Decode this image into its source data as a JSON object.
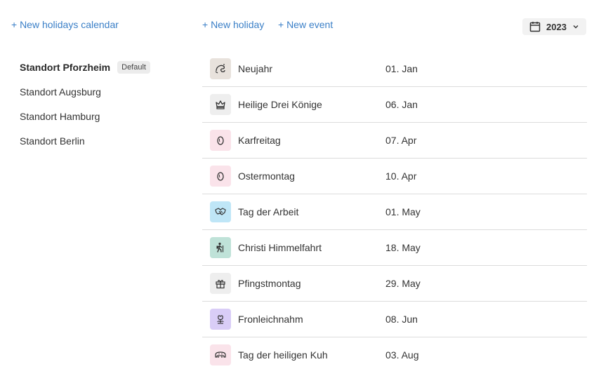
{
  "links": {
    "new_calendar": "+ New holidays calendar",
    "new_holiday": "+ New holiday",
    "new_event": "+ New event"
  },
  "year_select": {
    "value": "2023",
    "icon": "calendar-icon"
  },
  "sidebar": {
    "items": [
      {
        "label": "Standort Pforzheim",
        "badge": "Default",
        "active": true
      },
      {
        "label": "Standort Augsburg"
      },
      {
        "label": "Standort Hamburg"
      },
      {
        "label": "Standort Berlin"
      }
    ]
  },
  "holidays": [
    {
      "name": "Neujahr",
      "date": "01. Jan",
      "icon": "party-blower-icon",
      "color": "#e8e2dc"
    },
    {
      "name": "Heilige Drei Könige",
      "date": "06. Jan",
      "icon": "crown-icon",
      "color": "#eeeeee"
    },
    {
      "name": "Karfreitag",
      "date": "07. Apr",
      "icon": "egg-icon",
      "color": "#fae3ea"
    },
    {
      "name": "Ostermontag",
      "date": "10. Apr",
      "icon": "egg-icon",
      "color": "#fae3ea"
    },
    {
      "name": "Tag der Arbeit",
      "date": "01. May",
      "icon": "handshake-icon",
      "color": "#bfe6f7"
    },
    {
      "name": "Christi Himmelfahrt",
      "date": "18. May",
      "icon": "hiker-icon",
      "color": "#bfe2d8"
    },
    {
      "name": "Pfingstmontag",
      "date": "29. May",
      "icon": "gift-icon",
      "color": "#eeeeee"
    },
    {
      "name": "Fronleichnahm",
      "date": "08. Jun",
      "icon": "flower-icon",
      "color": "#d9cdf7"
    },
    {
      "name": "Tag der heiligen Kuh",
      "date": "03. Aug",
      "icon": "cow-icon",
      "color": "#fae3ea"
    }
  ]
}
